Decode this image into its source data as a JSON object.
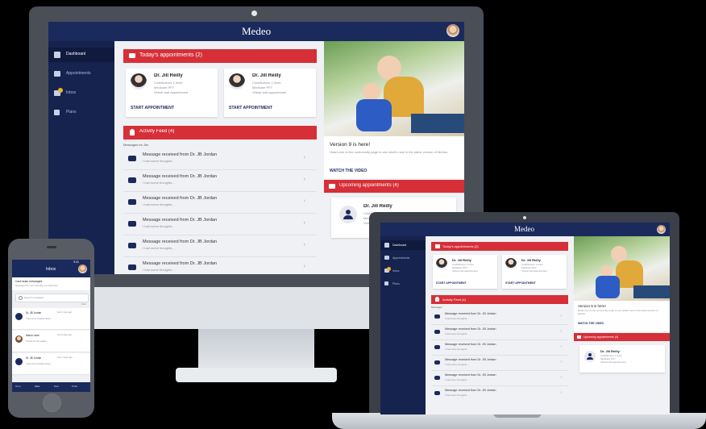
{
  "colors": {
    "navy": "#1b2a5c",
    "red": "#d62f38",
    "background": "#f0f1f4"
  },
  "app": {
    "brand": "Medeo"
  },
  "desktop": {
    "sidebar": [
      "Dashboard",
      "Appointments",
      "Inbox",
      "Plans"
    ],
    "todays_appointments": {
      "title": "Today's appointments (2)",
      "cards": [
        {
          "doctor": "Dr. Jill Reilly",
          "line1": "Cold/flu/sore 1.0min",
          "line2": "Medicare PFT",
          "line3": "Virtual visit appointment",
          "action": "START APPOINTMENT"
        },
        {
          "doctor": "Dr. Jill Reilly",
          "line1": "Cold/flu/sore 1.0min",
          "line2": "Medicare PFT",
          "line3": "Virtual visit appointment",
          "action": "START APPOINTMENT"
        }
      ]
    },
    "activity_feed": {
      "title": "Activity Feed (4)",
      "subheading": "Messages for Jim",
      "items": [
        {
          "title": "Message received from Dr. JB Jordan",
          "snippet": "I had some thoughts..."
        },
        {
          "title": "Message received from Dr. JB Jordan",
          "snippet": "I had some thoughts..."
        },
        {
          "title": "Message received from Dr. JB Jordan",
          "snippet": "I had some thoughts..."
        },
        {
          "title": "Message received from Dr. JB Jordan",
          "snippet": "I had some thoughts..."
        },
        {
          "title": "Message received from Dr. JB Jordan",
          "snippet": "I had some thoughts..."
        },
        {
          "title": "Message received from Dr. JB Jordan",
          "snippet": "I had some thoughts..."
        }
      ]
    },
    "promo": {
      "title": "Version 9 is here!",
      "body": "Head over to the community page to see what's new in the latest version of Medeo.",
      "link": "WATCH THE VIDEO"
    },
    "upcoming": {
      "title": "Upcoming appointments (4)",
      "card": {
        "doctor": "Dr. Jill Reilly",
        "line1": "Cold/flu/sore",
        "line2": "Medicare",
        "line3": "Virtual"
      }
    }
  },
  "laptop": {
    "sidebar": [
      "Dashboard",
      "Appointments",
      "Inbox",
      "Plans"
    ],
    "todays_appointments": {
      "title": "Today's appointments (2)"
    },
    "cards": [
      {
        "doctor": "Dr. Jill Reilly",
        "line1": "Cold/flu/sore 1.0min",
        "line2": "Medicare PFT",
        "line3": "Virtual visit appointment",
        "action": "START APPOINTMENT"
      },
      {
        "doctor": "Dr. Jill Reilly",
        "line1": "Cold/flu/sore 1.0min",
        "line2": "Medicare PFT",
        "line3": "Virtual visit appointment",
        "action": "START APPOINTMENT"
      }
    ],
    "activity_feed": {
      "title": "Activity Feed (4)",
      "subheading": "Messages",
      "items": [
        {
          "title": "Message received from Dr. JB Jordan",
          "snippet": "I had some thoughts..."
        },
        {
          "title": "Message received from Dr. JB Jordan",
          "snippet": "I had some thoughts..."
        },
        {
          "title": "Message received from Dr. JB Jordan",
          "snippet": "I had some thoughts..."
        },
        {
          "title": "Message received from Dr. JB Jordan",
          "snippet": "I had some thoughts..."
        },
        {
          "title": "Message received from Dr. JB Jordan",
          "snippet": "I had some thoughts..."
        },
        {
          "title": "Message received from Dr. JB Jordan",
          "snippet": "I had some thoughts..."
        }
      ]
    },
    "promo": {
      "title": "Version 9 is here!",
      "body": "Head over to the community page to see what's new in the latest version of Medeo.",
      "link": "WATCH THE VIDEO"
    },
    "upcoming": {
      "title": "Upcoming appointments (4)",
      "card": {
        "doctor": "Dr. Jill Reilly",
        "line1": "Cold/flu/sore 1.0min",
        "line2": "Medicare PFT",
        "line3": "Virtual visit appointment"
      }
    }
  },
  "phone": {
    "status_time": "9:41",
    "title": "Inbox",
    "banner_title": "Care team messages",
    "banner_sub": "Messages from your care team are listed here",
    "search_placeholder": "Search messages",
    "filter": "Filter",
    "messages": [
      {
        "sender": "Dr. JB Jordan",
        "meta": "Sent 2 days ago",
        "preview": "I had some thoughts about..."
      },
      {
        "sender": "Alison Lane",
        "meta": "Sent 4 days ago",
        "preview": "Thanks for the update..."
      },
      {
        "sender": "Dr. JB Jordan",
        "meta": "Sent 1 week ago",
        "preview": "I had some thoughts about..."
      }
    ],
    "tabs": [
      "Home",
      "Inbox",
      "Plans",
      "Profile"
    ]
  }
}
